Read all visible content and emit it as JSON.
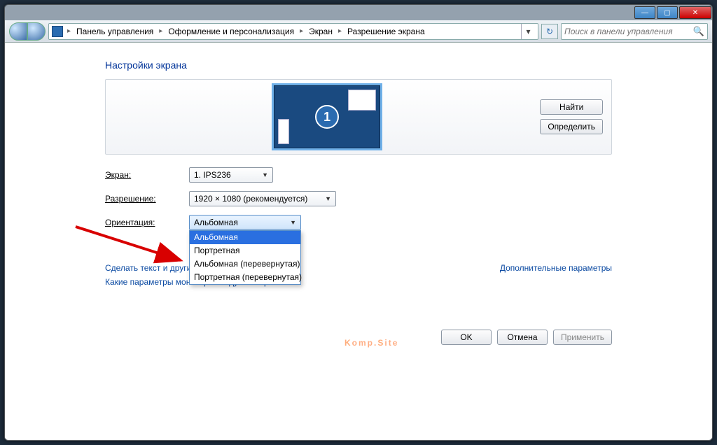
{
  "titlebar": {
    "min": "—",
    "max": "▢",
    "close": "✕"
  },
  "breadcrumb": {
    "root_icon": "control-panel-icon",
    "items": [
      "Панель управления",
      "Оформление и персонализация",
      "Экран",
      "Разрешение экрана"
    ]
  },
  "search": {
    "placeholder": "Поиск в панели управления"
  },
  "page": {
    "title": "Настройки экрана",
    "monitor_number": "1",
    "find_btn": "Найти",
    "detect_btn": "Определить"
  },
  "row_screen": {
    "label": "Экран:",
    "value": "1. IPS236"
  },
  "row_res": {
    "label": "Разрешение:",
    "value": "1920 × 1080 (рекомендуется)"
  },
  "row_orient": {
    "label": "Ориентация:",
    "value": "Альбомная",
    "options": [
      "Альбомная",
      "Портретная",
      "Альбомная (перевернутая)",
      "Портретная (перевернутая)"
    ],
    "selected_index": 0
  },
  "links": {
    "text_size": "Сделать текст и другие",
    "which_params": "Какие параметры монитора следует выбрать?",
    "advanced": "Дополнительные параметры"
  },
  "actions": {
    "ok": "OK",
    "cancel": "Отмена",
    "apply": "Применить"
  },
  "watermark": {
    "a": "K",
    "b": "omp.",
    "c": "S",
    "d": "ite"
  }
}
